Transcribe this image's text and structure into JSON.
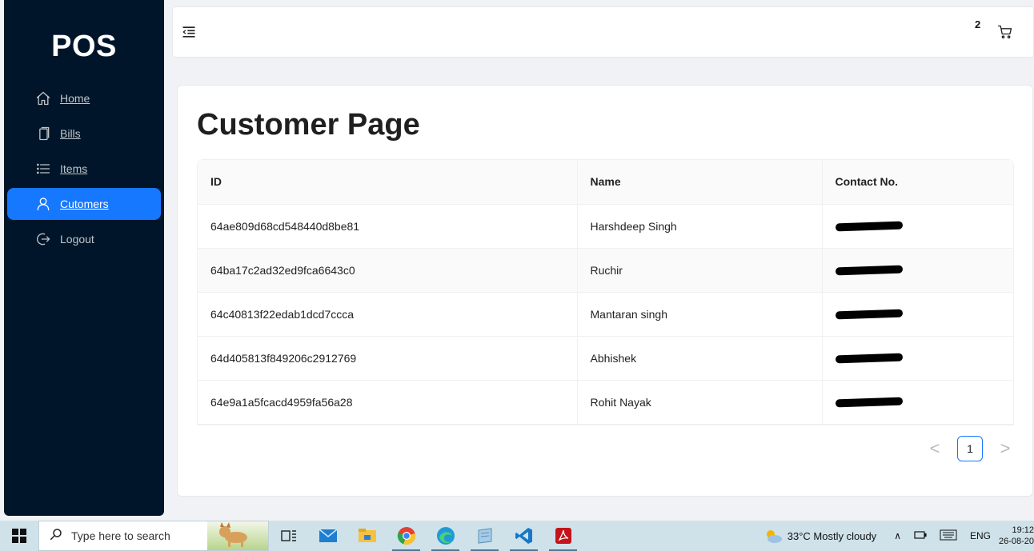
{
  "app": {
    "logo": "POS"
  },
  "sidebar": {
    "items": [
      {
        "label": "Home",
        "icon": "home-icon"
      },
      {
        "label": "Bills",
        "icon": "copy-icon"
      },
      {
        "label": "Items",
        "icon": "list-icon"
      },
      {
        "label": "Cutomers",
        "icon": "user-icon",
        "active": true
      },
      {
        "label": "Logout",
        "icon": "logout-icon"
      }
    ]
  },
  "header": {
    "cart_count": "2"
  },
  "main": {
    "title": "Customer Page",
    "table": {
      "columns": [
        "ID",
        "Name",
        "Contact No."
      ],
      "rows": [
        {
          "id": "64ae809d68cd548440d8be81",
          "name": "Harshdeep Singh"
        },
        {
          "id": "64ba17c2ad32ed9fca6643c0",
          "name": "Ruchir"
        },
        {
          "id": "64c40813f22edab1dcd7ccca",
          "name": "Mantaran singh"
        },
        {
          "id": "64d405813f849206c2912769",
          "name": "Abhishek"
        },
        {
          "id": "64e9a1a5fcacd4959fa56a28",
          "name": "Rohit Nayak"
        }
      ]
    },
    "pagination": {
      "current": "1",
      "prev": "<",
      "next": ">"
    }
  },
  "taskbar": {
    "search_placeholder": "Type here to search",
    "weather": "33°C  Mostly cloudy",
    "language": "ENG",
    "time": "19:12",
    "date": "26-08-20"
  },
  "colors": {
    "sidebar": "#001529",
    "accent": "#1677ff"
  }
}
